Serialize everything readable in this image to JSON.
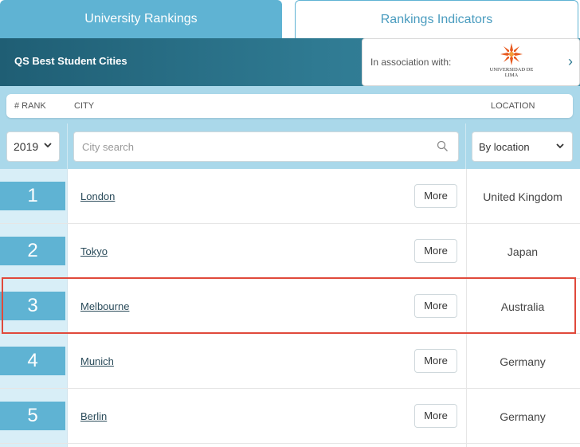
{
  "tabs": [
    {
      "label": "University Rankings"
    },
    {
      "label": "Rankings Indicators"
    }
  ],
  "banner": {
    "title": "QS Best Student Cities",
    "association_label": "In association with:",
    "partner_logo_text": "UNIVERSIDAD DE LIMA"
  },
  "table": {
    "headers": {
      "rank": "# RANK",
      "city": "CITY",
      "location": "LOCATION"
    },
    "filters": {
      "year": "2019",
      "search_placeholder": "City search",
      "location_select": "By location"
    },
    "more_label": "More",
    "rows": [
      {
        "rank": "1",
        "city": "London",
        "location": "United Kingdom"
      },
      {
        "rank": "2",
        "city": "Tokyo",
        "location": "Japan"
      },
      {
        "rank": "3",
        "city": "Melbourne",
        "location": "Australia"
      },
      {
        "rank": "4",
        "city": "Munich",
        "location": "Germany"
      },
      {
        "rank": "5",
        "city": "Berlin",
        "location": "Germany"
      }
    ]
  },
  "colors": {
    "accent": "#5fb3d3",
    "banner": "#2f7a92",
    "highlight": "#e0493b"
  }
}
